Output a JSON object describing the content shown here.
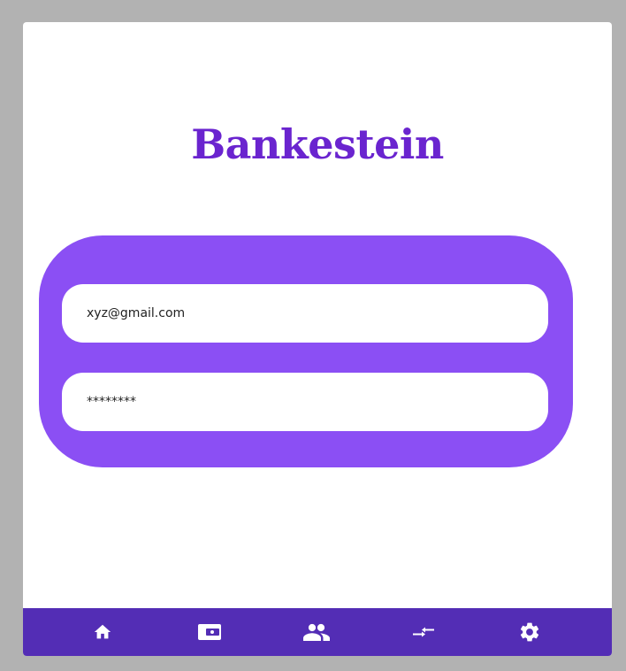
{
  "app": {
    "title": "Bankestein"
  },
  "login": {
    "email_value": "xyz@gmail.com",
    "password_value": "********"
  },
  "bottom_nav": {
    "items": [
      {
        "icon": "home-icon",
        "active": true
      },
      {
        "icon": "wallet-icon"
      },
      {
        "icon": "people-icon"
      },
      {
        "icon": "transfer-icon"
      },
      {
        "icon": "settings-icon"
      }
    ]
  },
  "colors": {
    "page_background": "#b2b2b2",
    "brand_purple": "#6a24cf",
    "card_purple": "#8b4ff4",
    "nav_background": "#532db5",
    "icon_color": "#ffffff"
  }
}
